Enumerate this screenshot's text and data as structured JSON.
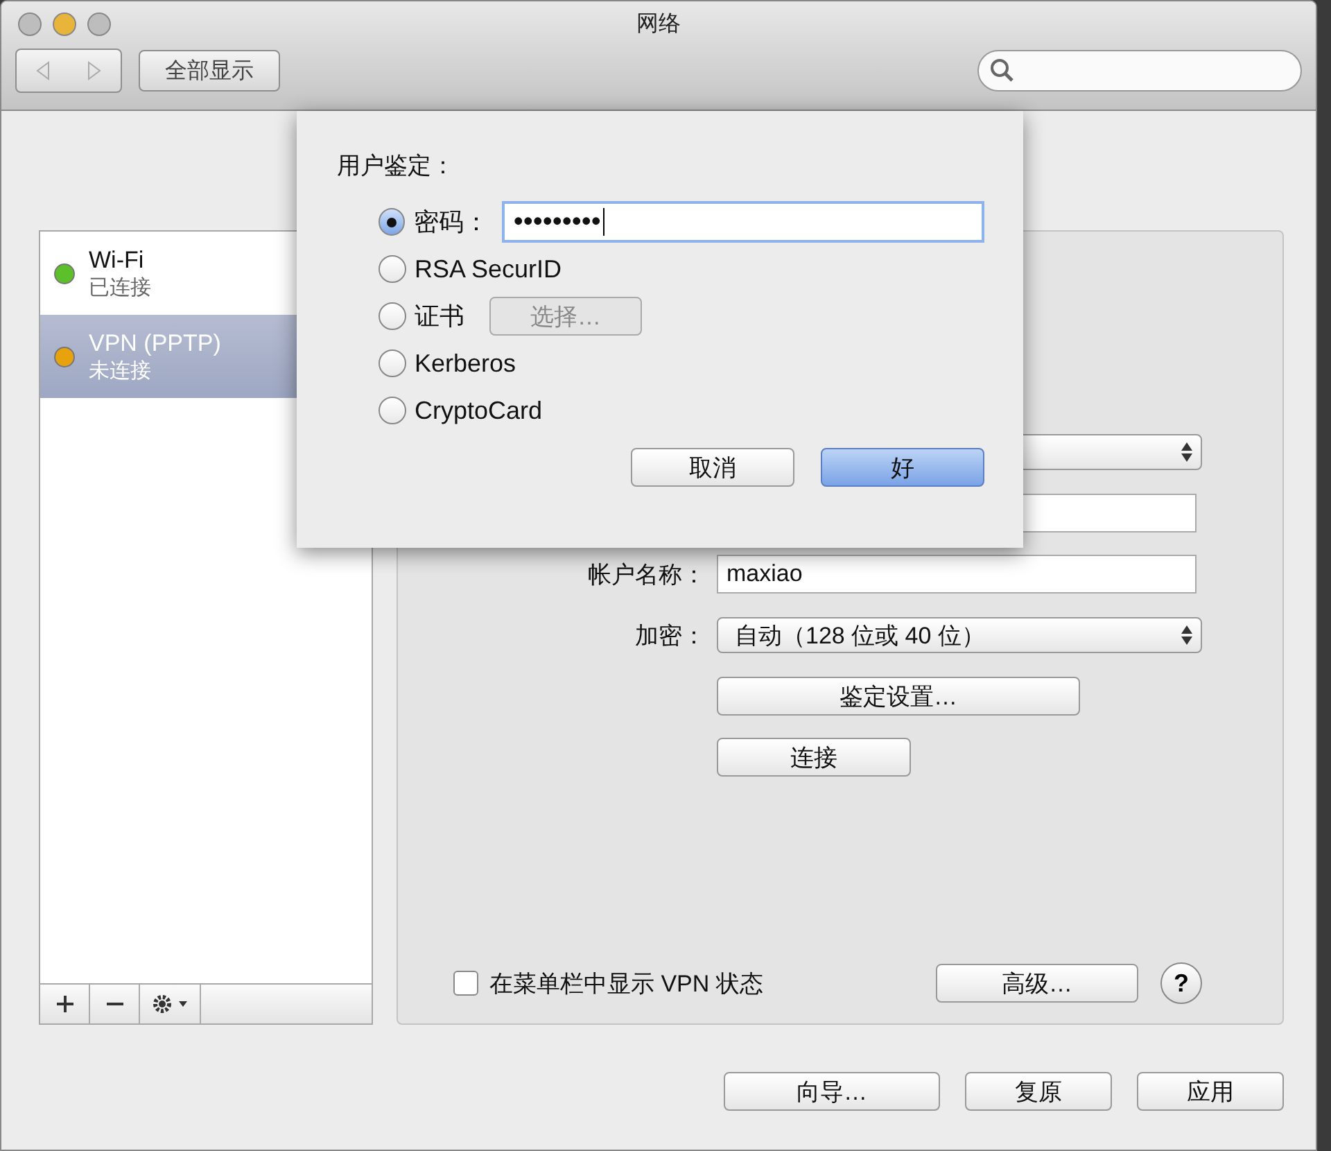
{
  "window": {
    "title": "网络"
  },
  "toolbar": {
    "show_all": "全部显示"
  },
  "services": [
    {
      "name": "Wi-Fi",
      "status": "已连接",
      "color": "#5cc02a",
      "selected": false
    },
    {
      "name": "VPN (PPTP)",
      "status": "未连接",
      "color": "#e8a20e",
      "selected": true
    }
  ],
  "form": {
    "account_label": "帐户名称：",
    "account_value": "maxiao",
    "encryption_label": "加密：",
    "encryption_value": "自动（128 位或 40 位）",
    "auth_button": "鉴定设置…",
    "connect_button": "连接"
  },
  "show_in_menubar": {
    "label": "在菜单栏中显示 VPN 状态",
    "checked": false
  },
  "advanced_button": "高级…",
  "help_button": "?",
  "buttons": [
    "向导…",
    "复原",
    "应用"
  ],
  "sheet": {
    "title": "用户鉴定：",
    "options": [
      {
        "kind": "password",
        "label": "密码：",
        "selected": true,
        "value": "•••••••••"
      },
      {
        "kind": "plain",
        "label": "RSA SecurID",
        "selected": false
      },
      {
        "kind": "chooser",
        "label": "证书",
        "selected": false,
        "button": "选择…"
      },
      {
        "kind": "plain",
        "label": "Kerberos",
        "selected": false
      },
      {
        "kind": "plain",
        "label": "CryptoCard",
        "selected": false
      }
    ],
    "cancel": "取消",
    "ok": "好"
  }
}
